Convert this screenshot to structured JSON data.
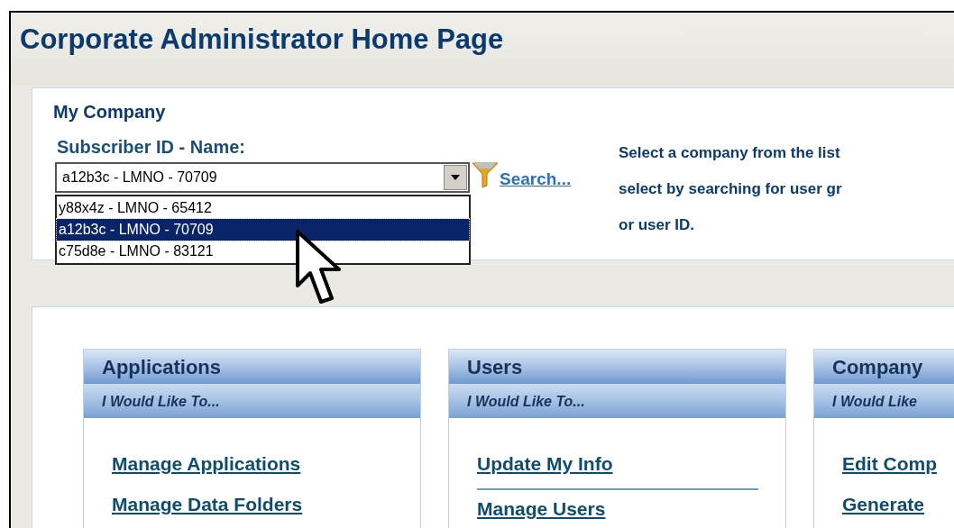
{
  "page": {
    "title": "Corporate Administrator Home Page"
  },
  "my_company": {
    "heading": "My Company",
    "label": "Subscriber ID - Name:",
    "select": {
      "value": "a12b3c - LMNO - 70709",
      "expanded": true,
      "options": [
        {
          "label": "y88x4z - LMNO - 65412",
          "selected": false
        },
        {
          "label": "a12b3c - LMNO - 70709",
          "selected": true
        },
        {
          "label": "c75d8e - LMNO - 83121",
          "selected": false
        }
      ]
    },
    "search_link": "Search...",
    "help_lines": [
      "Select a company from the list",
      "select by searching for user gr",
      "or user ID."
    ]
  },
  "cards": [
    {
      "title": "Applications",
      "subtitle": "I Would Like To...",
      "items": [
        {
          "kind": "link",
          "label": "Manage Applications"
        },
        {
          "kind": "link",
          "label": "Manage Data Folders"
        }
      ]
    },
    {
      "title": "Users",
      "subtitle": "I Would Like To...",
      "items": [
        {
          "kind": "link",
          "label": "Update My Info"
        },
        {
          "kind": "separator"
        },
        {
          "kind": "link",
          "label": "Manage Users"
        }
      ]
    },
    {
      "title": "Company",
      "subtitle": "I Would Like",
      "items": [
        {
          "kind": "link",
          "label": "Edit Comp"
        },
        {
          "kind": "link",
          "label": "Generate"
        }
      ]
    }
  ]
}
